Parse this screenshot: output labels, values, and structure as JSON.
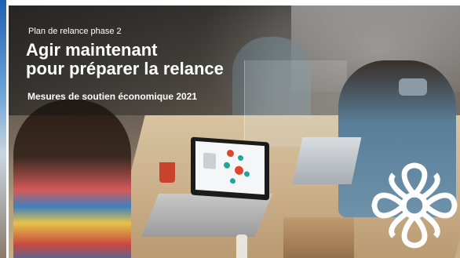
{
  "hero": {
    "eyebrow": "Plan de relance phase 2",
    "title_line1": "Agir maintenant",
    "title_line2": "pour préparer la relance",
    "subtitle": "Mesures de soutien économique 2021",
    "image_alt": "Coworkers at desks with laptops and plexiglass dividers",
    "logo_icon": "montreal-rosette-logo-icon"
  },
  "colors": {
    "text": "#ffffff",
    "logo": "#ffffff",
    "mug": "#c9432a",
    "screen_node_red": "#e2452e",
    "screen_node_teal": "#1fa79a"
  }
}
